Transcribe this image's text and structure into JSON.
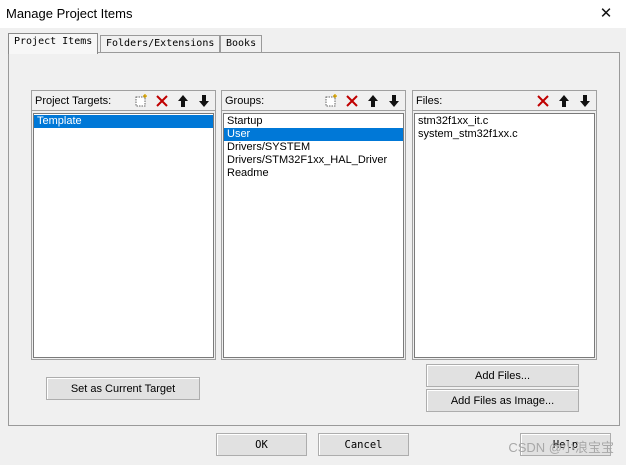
{
  "window": {
    "title": "Manage Project Items"
  },
  "tabs": [
    {
      "label": "Project Items"
    },
    {
      "label": "Folders/Extensions"
    },
    {
      "label": "Books"
    }
  ],
  "targets": {
    "label": "Project Targets:",
    "items": [
      "Template"
    ],
    "selected_index": 0
  },
  "groups": {
    "label": "Groups:",
    "items": [
      "Startup",
      "User",
      "Drivers/SYSTEM",
      "Drivers/STM32F1xx_HAL_Driver",
      "Readme"
    ],
    "selected_index": 1
  },
  "files": {
    "label": "Files:",
    "items": [
      "stm32f1xx_it.c",
      "system_stm32f1xx.c"
    ]
  },
  "buttons": {
    "set_current_target": "Set as Current Target",
    "add_files": "Add Files...",
    "add_files_as_image": "Add Files as Image...",
    "ok": "OK",
    "cancel": "Cancel",
    "help": "Help"
  },
  "watermark": "CSDN @小浪宝宝",
  "colors": {
    "selection": "#0078d7",
    "delete_icon": "#c00000"
  }
}
